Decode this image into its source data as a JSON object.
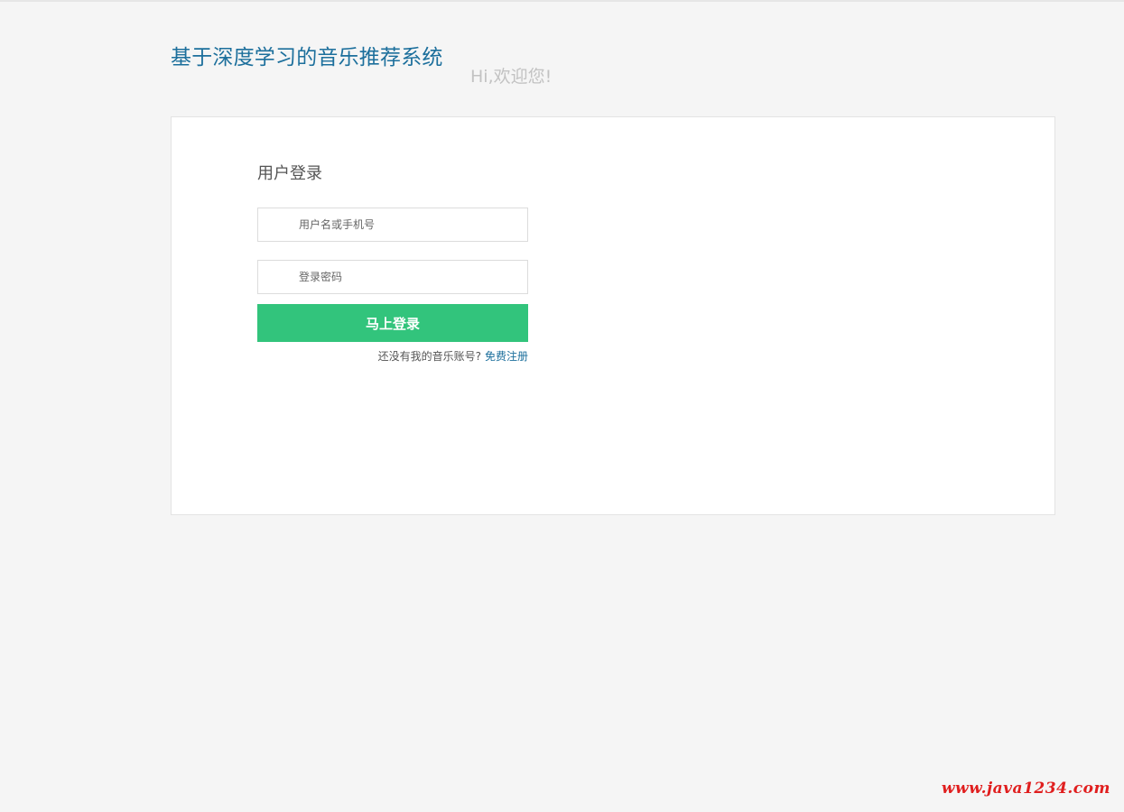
{
  "header": {
    "site_title": "基于深度学习的音乐推荐系统",
    "welcome_text": "Hi,欢迎您!"
  },
  "login_form": {
    "heading": "用户登录",
    "username_placeholder": "用户名或手机号",
    "password_placeholder": "登录密码",
    "submit_label": "马上登录",
    "register_prompt": "还没有我的音乐账号?",
    "register_link": "免费注册",
    "icons": {
      "username": "user-icon",
      "password": "lock-icon"
    }
  },
  "watermark": "www.java1234.com",
  "colors": {
    "title": "#1c6f9c",
    "accent_button": "#32c47c",
    "watermark": "#e01e1e"
  }
}
